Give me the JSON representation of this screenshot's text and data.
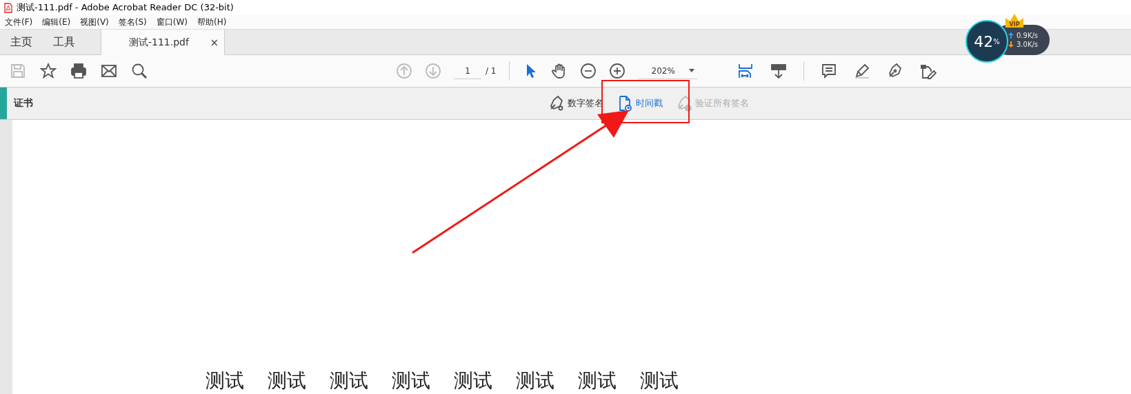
{
  "window": {
    "title": "测试-111.pdf - Adobe Acrobat Reader DC (32-bit)"
  },
  "menu": [
    "文件(F)",
    "编辑(E)",
    "视图(V)",
    "签名(S)",
    "窗口(W)",
    "帮助(H)"
  ],
  "tabs": [
    {
      "label": "主页",
      "selected": false
    },
    {
      "label": "工具",
      "selected": false
    },
    {
      "label": "测试-111.pdf",
      "selected": true,
      "close": "×"
    }
  ],
  "toolbar": {
    "left": [
      {
        "kind": "save",
        "disabled": true
      },
      {
        "kind": "star",
        "disabled": false
      },
      {
        "kind": "print",
        "disabled": false
      },
      {
        "kind": "mail",
        "disabled": false
      },
      {
        "kind": "search",
        "disabled": false
      }
    ],
    "nav": [
      {
        "kind": "up",
        "disabled": true
      },
      {
        "kind": "down",
        "disabled": true
      }
    ],
    "page": "1",
    "page_total": "/ 1",
    "tools": [
      {
        "kind": "pointer",
        "selected": true
      },
      {
        "kind": "hand",
        "selected": false
      },
      {
        "kind": "zoom-out",
        "selected": false
      },
      {
        "kind": "zoom-in",
        "selected": false
      }
    ],
    "zoom": "202%",
    "right": [
      {
        "kind": "fit"
      },
      {
        "kind": "scroll"
      },
      {
        "kind": "comment"
      },
      {
        "kind": "highlight"
      },
      {
        "kind": "sign"
      },
      {
        "kind": "edit"
      }
    ]
  },
  "cert_bar": {
    "title": "证书",
    "buttons": [
      {
        "kind": "digital",
        "label": "数字签名",
        "selected": false,
        "disabled": false
      },
      {
        "kind": "timestamp",
        "label": "时间戳",
        "selected": true,
        "disabled": false
      },
      {
        "kind": "verify",
        "label": "验证所有签名",
        "selected": false,
        "disabled": true
      }
    ]
  },
  "document": {
    "words": [
      "测试",
      "测试",
      "测试",
      "测试",
      "测试",
      "测试",
      "测试",
      "测试"
    ]
  },
  "speed_widget": {
    "percent": "42",
    "percent_unit": "%",
    "upload": "0.9",
    "upload_unit": "K/s",
    "download": "3.0",
    "download_unit": "K/s",
    "badge": "VIP"
  }
}
